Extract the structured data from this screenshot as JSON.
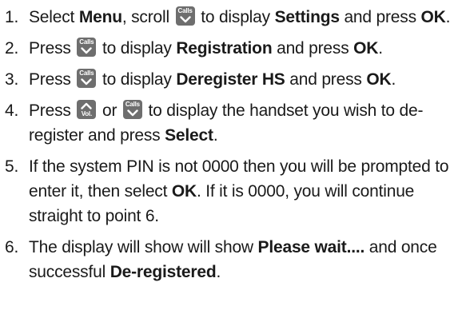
{
  "keys": {
    "calls_label": "Calls",
    "vol_label": "Vol."
  },
  "steps": [
    {
      "num": "1.",
      "t1": "Select ",
      "b1": "Menu",
      "t2": ", scroll ",
      "t3": " to display ",
      "b2": "Settings",
      "t4": " and press ",
      "b3": "OK",
      "t5": "."
    },
    {
      "num": "2.",
      "t1": "Press ",
      "t2": " to display ",
      "b1": "Registration",
      "t3": " and press ",
      "b2": "OK",
      "t4": "."
    },
    {
      "num": "3.",
      "t1": "Press ",
      "t2": " to display ",
      "b1": "Deregister HS",
      "t3": " and press ",
      "b2": "OK",
      "t4": "."
    },
    {
      "num": "4.",
      "t1": "Press ",
      "t2": " or ",
      "t3": " to display the handset you wish to de-register and press ",
      "b1": "Select",
      "t4": "."
    },
    {
      "num": "5.",
      "t1": "If the system PIN is not 0000 then you will be prompted to enter it, then select ",
      "b1": "OK",
      "t2": ". If it is 0000, you will continue straight to point 6."
    },
    {
      "num": "6.",
      "t1": "The display will show will show ",
      "b1": "Please wait....",
      "t2": " and once successful ",
      "b2": "De-registered",
      "t3": "."
    }
  ]
}
